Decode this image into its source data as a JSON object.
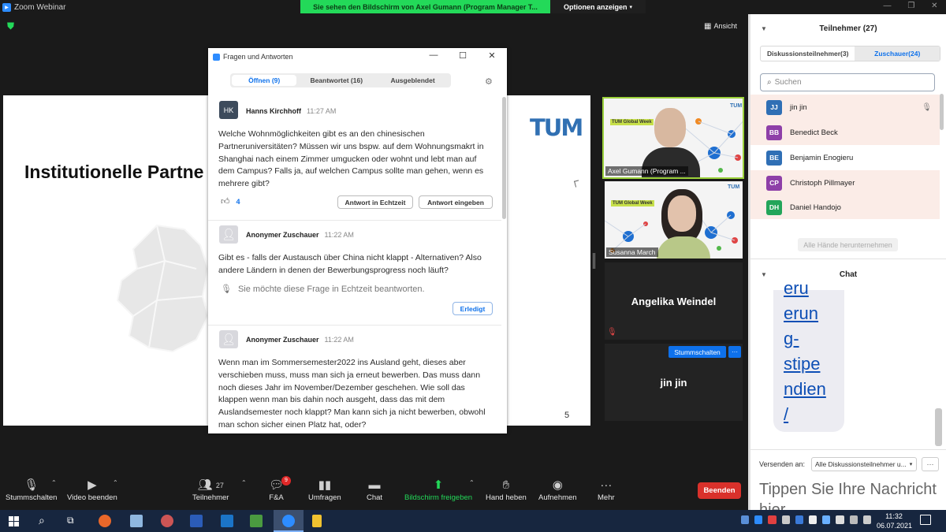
{
  "window": {
    "title": "Zoom Webinar"
  },
  "share_banner": {
    "text": "Sie sehen den Bildschirm von Axel Gumann (Program Manager T...",
    "options": "Optionen anzeigen"
  },
  "view_button": "Ansicht",
  "slide": {
    "title": "Institutionelle Partne",
    "logo": "TUM",
    "page_number": "5"
  },
  "qa": {
    "title": "Fragen und Antworten",
    "tabs": [
      "Öffnen (9)",
      "Beantwortet (16)",
      "Ausgeblendet"
    ],
    "questions": [
      {
        "initials": "HK",
        "author": "Hanns Kirchhoff",
        "time": "11:27 AM",
        "text": "Welche Wohnmöglichkeiten gibt es an den chinesischen Partneruniversitäten? Müssen wir uns bspw. auf dem Wohnungsmakrt in Shanghai nach einem Zimmer umgucken oder wohnt und lebt man auf dem Campus? Falls ja, auf welchen Campus sollte man gehen, wenn es mehrere gibt?",
        "likes": "4",
        "btn_live": "Antwort in Echtzeit",
        "btn_type": "Antwort eingeben"
      },
      {
        "author": "Anonymer Zuschauer",
        "time": "11:22 AM",
        "text": "Gibt es - falls der Austausch über China nicht klappt - Alternativen? Also andere Ländern in denen der Bewerbungsprogress noch läuft?",
        "note": "Sie möchte diese Frage in Echtzeit beantworten.",
        "btn_done": "Erledigt"
      },
      {
        "author": "Anonymer Zuschauer",
        "time": "11:22 AM",
        "text": "Wenn man im Sommersemester2022 ins Ausland geht, dieses aber verschieben muss, muss man sich ja erneut bewerben. Das muss dann noch dieses Jahr im November/Dezember geschehen. Wie soll das klappen wenn man bis dahin noch ausgeht, dass das mit dem Auslandsemester noch klappt? Man kann sich ja nicht bewerben, obwohl man schon sicher einen Platz hat, oder?"
      }
    ]
  },
  "videos": [
    {
      "label": "Axel Gumann (Program ...",
      "slide_tag": "TUM Global Week"
    },
    {
      "label": "Susanna March",
      "slide_tag": "TUM Global Week"
    },
    {
      "name": "Angelika Weindel"
    },
    {
      "name": "jin jin",
      "mute_button": "Stummschalten",
      "more": "···"
    }
  ],
  "participants": {
    "title": "Teilnehmer (27)",
    "tabs": [
      "Diskussionsteilnehmer(3)",
      "Zuschauer(24)"
    ],
    "search_placeholder": "Suchen",
    "list": [
      {
        "initials": "JJ",
        "name": "jin jin",
        "color": "#2f6fb5"
      },
      {
        "initials": "BB",
        "name": "Benedict Beck",
        "color": "#8e3fa8"
      },
      {
        "initials": "BE",
        "name": "Benjamin Enogieru",
        "color": "#2f6fb5"
      },
      {
        "initials": "CP",
        "name": "Christoph Pillmayer",
        "color": "#8e3fa8"
      },
      {
        "initials": "DH",
        "name": "Daniel Handojo",
        "color": "#23a55a"
      }
    ],
    "lower_hands": "Alle Hände herunternehmen"
  },
  "chat": {
    "title": "Chat",
    "message_lines": [
      "eru",
      "erun",
      "g-",
      "stipe",
      "ndien",
      "/"
    ],
    "send_to_label": "Versenden an:",
    "send_to_value": "Alle Diskussionsteilnehmer u...",
    "more": "···",
    "input_placeholder": "Tippen Sie Ihre Nachricht hier..."
  },
  "toolbar": {
    "mute": "Stummschalten",
    "video": "Video beenden",
    "participants": "Teilnehmer",
    "participants_count": "27",
    "qa": "F&A",
    "qa_badge": "9",
    "polls": "Umfragen",
    "chat": "Chat",
    "share": "Bildschirm freigeben",
    "raise_hand": "Hand heben",
    "record": "Aufnehmen",
    "more": "Mehr",
    "end": "Beenden"
  },
  "taskbar": {
    "time": "11:32",
    "date": "06.07.2021"
  },
  "colors": {
    "accent": "#0e71eb",
    "share_green": "#23d959",
    "end_red": "#d9312b",
    "tum_blue": "#3070b3"
  }
}
